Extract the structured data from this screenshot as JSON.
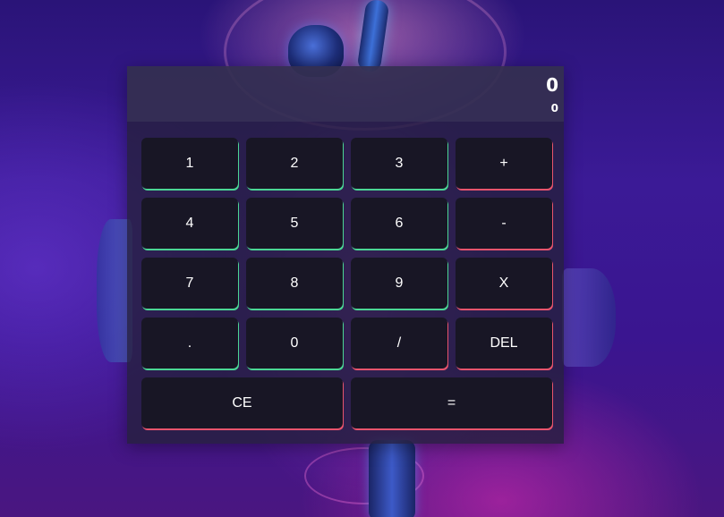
{
  "display": {
    "current_value": "0",
    "previous_value": "0"
  },
  "accent_colors": {
    "digit_key_border": "#4bd695",
    "operator_key_border": "#e8546d",
    "key_background": "#181625"
  },
  "keypad": {
    "key_1": "1",
    "key_2": "2",
    "key_3": "3",
    "key_plus": "+",
    "key_4": "4",
    "key_5": "5",
    "key_6": "6",
    "key_minus": "-",
    "key_7": "7",
    "key_8": "8",
    "key_9": "9",
    "key_multiply": "X",
    "key_decimal": ".",
    "key_0": "0",
    "key_divide": "/",
    "key_delete": "DEL",
    "key_clear": "CE",
    "key_equals": "="
  }
}
